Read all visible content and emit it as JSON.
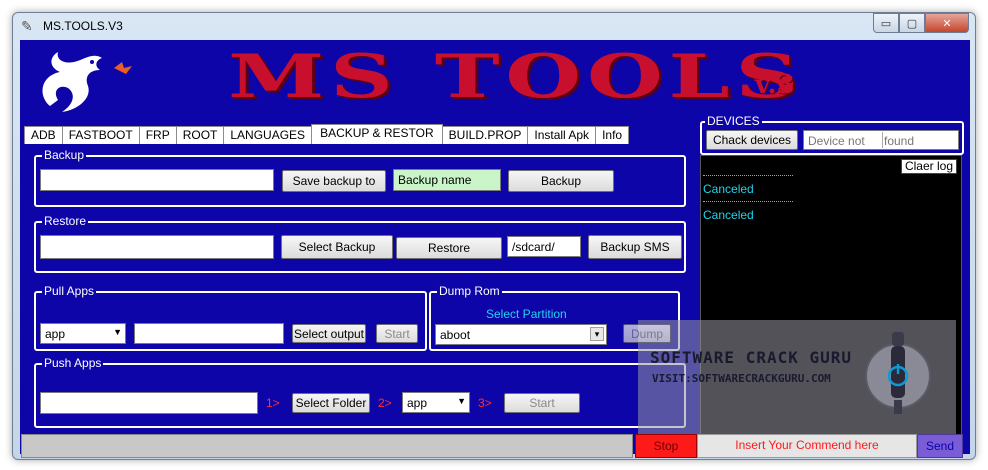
{
  "window": {
    "title": "MS.TOOLS.V3",
    "min_glyph": "▭",
    "max_glyph": "▢",
    "close_glyph": "✕"
  },
  "logo": {
    "title": "MS TOOLS",
    "version": "v.3"
  },
  "tabs": [
    {
      "label": "ADB"
    },
    {
      "label": "FASTBOOT"
    },
    {
      "label": "FRP"
    },
    {
      "label": "ROOT"
    },
    {
      "label": "LANGUAGES"
    },
    {
      "label": "BACKUP & RESTOR",
      "active": true
    },
    {
      "label": "BUILD.PROP"
    },
    {
      "label": "Install Apk"
    },
    {
      "label": "Info"
    }
  ],
  "backup": {
    "title": "Backup",
    "path_value": "",
    "save_button": "Save backup to",
    "name_value": "Backup name",
    "backup_button": "Backup"
  },
  "restore": {
    "title": "Restore",
    "path_value": "",
    "select_button": "Select Backup",
    "restore_button": "Restore",
    "sdcard_value": "/sdcard/",
    "sms_button": "Backup SMS"
  },
  "pull_apps": {
    "title": "Pull Apps",
    "select_value": "app",
    "output_value": "",
    "output_button": "Select output",
    "start_button": "Start"
  },
  "dump_rom": {
    "title": "Dump Rom",
    "partition_label": "Select Partition",
    "partition_value": "aboot",
    "dump_button": "Dump"
  },
  "push_apps": {
    "title": "Push Apps",
    "folder_value": "",
    "step1": "1>",
    "folder_button": "Select Folder",
    "step2": "2>",
    "select_value": "app",
    "step3": "3>",
    "start_button": "Start"
  },
  "devices": {
    "title": "DEVICES",
    "check_button": "Chack devices",
    "status_left": "Device not",
    "status_right": "found"
  },
  "log": {
    "clear_button": "Claer log",
    "lines": [
      "Canceled",
      "Canceled"
    ]
  },
  "bottom": {
    "status_value": "",
    "stop_button": "Stop",
    "command_placeholder": "Insert Your Commend here",
    "send_button": "Send"
  },
  "watermark": {
    "line1": "SOFTWARE CRACK GURU",
    "line2": "VISIT:SOFTWARECRACKGURU.COM"
  },
  "colors": {
    "background": "#0d05a8",
    "accent_red": "#c8102e",
    "log_text": "#22d3ee",
    "stop": "#ff1a1a",
    "send": "#7a5cd6"
  }
}
